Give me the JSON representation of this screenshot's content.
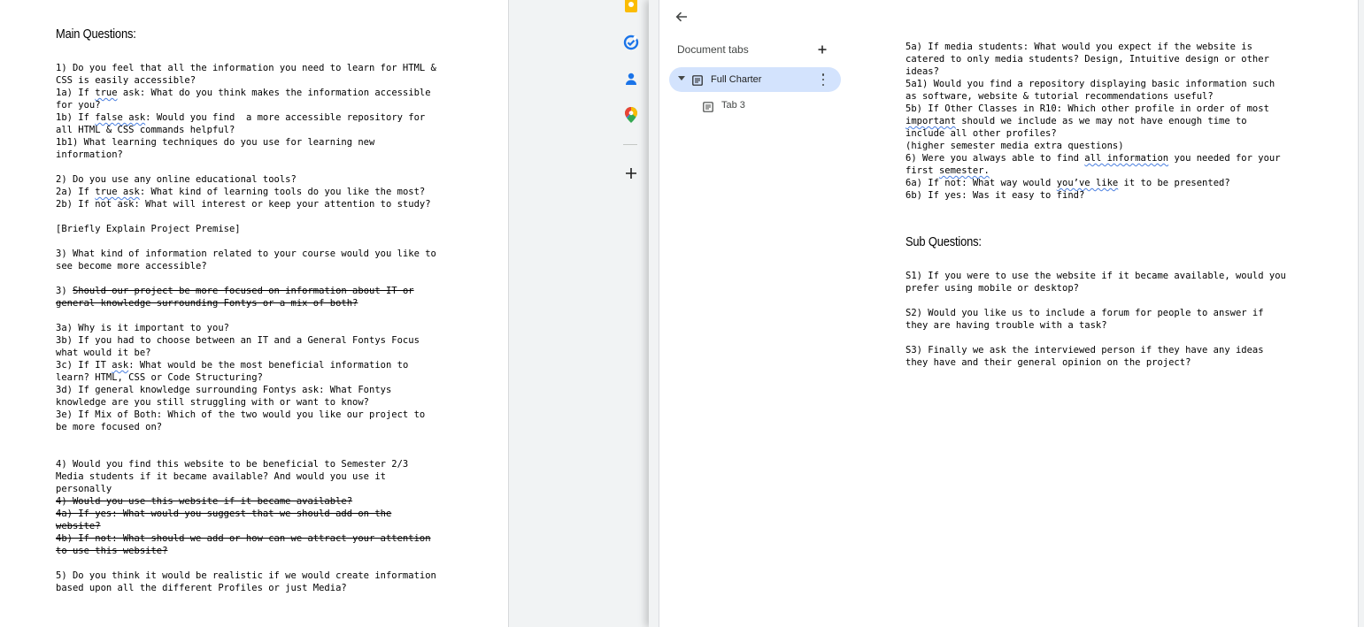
{
  "left_doc": {
    "heading": "Main Questions:",
    "lines": [
      {
        "text": "1) Do you feel that all the information you need to learn for HTML &"
      },
      {
        "text": "CSS is easily accessible?"
      },
      {
        "text": "1a) If true ask: What do you think makes the information accessible"
      },
      {
        "text": "for you?"
      },
      {
        "text": "1b) If false ask: Would you find  a more accessible repository for"
      },
      {
        "text": "all HTML & CSS commands helpful?"
      },
      {
        "text": "1b1) What learning techniques do you use for learning new"
      },
      {
        "text": "information?"
      },
      {
        "text": ""
      },
      {
        "text": "2) Do you use any online educational tools?"
      },
      {
        "text": "2a) If true ask: What kind of learning tools do you like the most?"
      },
      {
        "text": "2b) If not ask: What will interest or keep your attention to study?"
      },
      {
        "text": ""
      },
      {
        "text": "[Briefly Explain Project Premise]"
      },
      {
        "text": ""
      },
      {
        "text": "3) What kind of information related to your course would you like to"
      },
      {
        "text": "see become more accessible?"
      },
      {
        "text": ""
      },
      {
        "text": "3) Should our project be more focused on information about IT or"
      },
      {
        "text": "general knowledge surrounding Fontys or a mix of both?"
      },
      {
        "text": ""
      },
      {
        "text": "3a) Why is it important to you?"
      },
      {
        "text": "3b) If you had to choose between an IT and a General Fontys Focus"
      },
      {
        "text": "what would it be?"
      },
      {
        "text": "3c) If IT ask: What would be the most beneficial information to"
      },
      {
        "text": "learn? HTML, CSS or Code Structuring?"
      },
      {
        "text": "3d) If general knowledge surrounding Fontys ask: What Fontys"
      },
      {
        "text": "knowledge are you still struggling with or want to know?"
      },
      {
        "text": "3e) If Mix of Both: Which of the two would you like our project to"
      },
      {
        "text": "be more focused on?"
      },
      {
        "text": ""
      },
      {
        "text": ""
      },
      {
        "text": "4) Would you find this website to be beneficial to Semester 2/3"
      },
      {
        "text": "Media students if it became available? And would you use it"
      },
      {
        "text": "personally"
      },
      {
        "text": "4) Would you use this website if it became available?"
      },
      {
        "text": "4a) If yes: What would you suggest that we should add on the"
      },
      {
        "text": "website?"
      },
      {
        "text": "4b) If not: What should we add or how can we attract your attention"
      },
      {
        "text": "to use this website?"
      },
      {
        "text": ""
      },
      {
        "text": "5) Do you think it would be realistic if we would create information"
      },
      {
        "text": "based upon all the different Profiles or just Media?"
      }
    ]
  },
  "tabs_panel": {
    "title": "Document tabs",
    "tabs": [
      {
        "label": "Full Charter"
      },
      {
        "label": "Tab 3"
      }
    ]
  },
  "right_doc": {
    "lines": [
      {
        "text": "5a) If media students: What would you expect if the website is"
      },
      {
        "text": "catered to only media students? Design, Intuitive design or other"
      },
      {
        "text": "ideas?"
      },
      {
        "text": "5a1) Would you find a repository displaying basic information such"
      },
      {
        "text": "as software, website & tutorial recommendations useful?"
      },
      {
        "text": "5b) If Other Classes in R10: Which other profile in order of most"
      },
      {
        "text": "important should we include as we may not have enough time to"
      },
      {
        "text": "include all other profiles?"
      },
      {
        "text": "(higher semester media extra questions)"
      },
      {
        "text": "6) Were you always able to find all information you needed for your"
      },
      {
        "text": "first semester."
      },
      {
        "text": "6a) If not: What way would you’ve like it to be presented?"
      },
      {
        "text": "6b) If yes: Was it easy to find?"
      }
    ],
    "sub_heading": "Sub Questions:",
    "sub_lines": [
      {
        "text": "S1) If you were to use the website if it became available, would you"
      },
      {
        "text": "prefer using mobile or desktop?"
      },
      {
        "text": ""
      },
      {
        "text": "S2) Would you like us to include a forum for people to answer if"
      },
      {
        "text": "they are having trouble with a task?"
      },
      {
        "text": ""
      },
      {
        "text": "S3) Finally we ask the interviewed person if they have any ideas"
      },
      {
        "text": "they have and their general opinion on the project?"
      }
    ]
  },
  "side_panel": {
    "icons": [
      "keep-icon",
      "tasks-icon",
      "contacts-icon",
      "maps-icon",
      "add-icon"
    ]
  },
  "colors": {
    "active_tab_bg": "#d3e3fd",
    "spellcheck": "#4a7fe0"
  }
}
